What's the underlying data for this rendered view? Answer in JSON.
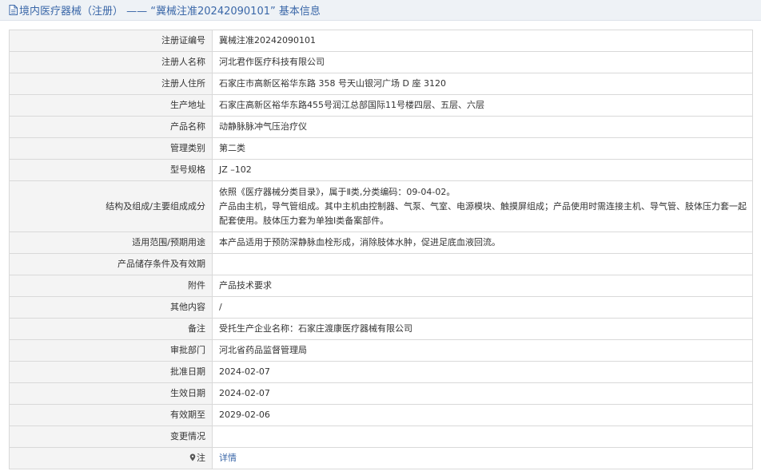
{
  "header": {
    "title": "境内医疗器械（注册） —— “冀械注准20242090101” 基本信息",
    "icon": "document-icon"
  },
  "rows": [
    {
      "label": "注册证编号",
      "value": "冀械注准20242090101"
    },
    {
      "label": "注册人名称",
      "value": "河北君作医疗科技有限公司"
    },
    {
      "label": "注册人住所",
      "value": "石家庄市高新区裕华东路 358 号天山银河广场 D 座 3120"
    },
    {
      "label": "生产地址",
      "value": "石家庄高新区裕华东路455号润江总部国际11号楼四层、五层、六层"
    },
    {
      "label": "产品名称",
      "value": "动静脉脉冲气压治疗仪"
    },
    {
      "label": "管理类别",
      "value": "第二类"
    },
    {
      "label": "型号规格",
      "value": "JZ –102"
    },
    {
      "label": "结构及组成/主要组成成分",
      "lines": [
        "依照《医疗器械分类目录》，属于Ⅱ类,分类编码：09-04-02。",
        "产品由主机，导气管组成。其中主机由控制器、气泵、气室、电源模块、触摸屏组成；产品使用时需连接主机、导气管、肢体压力套一起配套使用。肢体压力套为单独Ⅰ类备案部件。"
      ]
    },
    {
      "label": "适用范围/预期用途",
      "value": "本产品适用于预防深静脉血栓形成，消除肢体水肿，促进足底血液回流。"
    },
    {
      "label": "产品储存条件及有效期",
      "value": ""
    },
    {
      "label": "附件",
      "value": "产品技术要求"
    },
    {
      "label": "其他内容",
      "value": "/"
    },
    {
      "label": "备注",
      "value": "受托生产企业名称：石家庄渡康医疗器械有限公司"
    },
    {
      "label": "审批部门",
      "value": "河北省药品监督管理局"
    },
    {
      "label": "批准日期",
      "value": "2024-02-07"
    },
    {
      "label": "生效日期",
      "value": "2024-02-07"
    },
    {
      "label": "有效期至",
      "value": "2029-02-06"
    },
    {
      "label": "变更情况",
      "value": ""
    }
  ],
  "note": {
    "label": "注",
    "icon": "pin-icon",
    "link_text": "详情"
  },
  "colors": {
    "title": "#3a67a8",
    "label_bg": "#f4f4f4",
    "border": "#d9d9d9",
    "header_bg": "#eef2f6"
  }
}
